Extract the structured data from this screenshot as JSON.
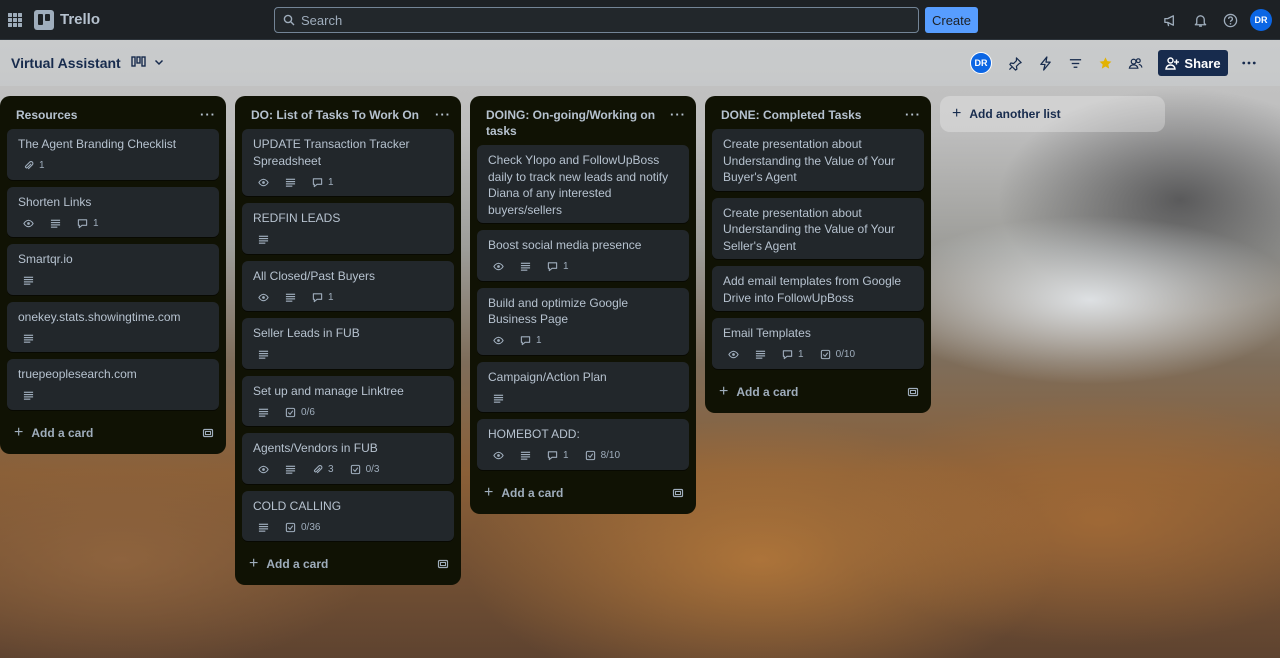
{
  "nav": {
    "app_name": "Trello",
    "search_placeholder": "Search",
    "create_label": "Create",
    "avatar_initials": "DR"
  },
  "board": {
    "title": "Virtual Assistant",
    "member_initials": "DR",
    "share_label": "Share"
  },
  "lists": [
    {
      "title": "Resources",
      "add_card_label": "Add a card",
      "cards": [
        {
          "title": "The Agent Branding Checklist",
          "attachments": "1"
        },
        {
          "title": "Shorten Links",
          "comments": "1"
        },
        {
          "title": "Smartqr.io"
        },
        {
          "title": "onekey.stats.showingtime.com"
        },
        {
          "title": "truepeoplesearch.com"
        }
      ]
    },
    {
      "title": "DO: List of Tasks To Work On",
      "add_card_label": "Add a card",
      "cards": [
        {
          "title": "UPDATE Transaction Tracker Spreadsheet",
          "comments": "1"
        },
        {
          "title": "REDFIN LEADS"
        },
        {
          "title": "All Closed/Past Buyers",
          "comments": "1"
        },
        {
          "title": "Seller Leads in FUB"
        },
        {
          "title": "Set up and manage Linktree",
          "checklist": "0/6"
        },
        {
          "title": "Agents/Vendors in FUB",
          "attachments": "3",
          "checklist": "0/3"
        },
        {
          "title": "COLD CALLING",
          "checklist": "0/36"
        }
      ]
    },
    {
      "title": "DOING: On-going/Working on tasks",
      "add_card_label": "Add a card",
      "cards": [
        {
          "title": "Check Ylopo and FollowUpBoss daily to track new leads and notify Diana of any interested buyers/sellers"
        },
        {
          "title": "Boost social media presence",
          "comments": "1"
        },
        {
          "title": "Build and optimize Google Business Page",
          "comments": "1"
        },
        {
          "title": "Campaign/Action Plan"
        },
        {
          "title": "HOMEBOT ADD:",
          "comments": "1",
          "checklist": "8/10"
        }
      ]
    },
    {
      "title": "DONE: Completed Tasks",
      "add_card_label": "Add a card",
      "cards": [
        {
          "title": "Create presentation about Understanding the Value of Your Buyer's Agent"
        },
        {
          "title": "Create presentation about Understanding the Value of Your Seller's Agent"
        },
        {
          "title": "Add email templates from Google Drive into FollowUpBoss"
        },
        {
          "title": "Email Templates",
          "comments": "1",
          "checklist": "0/10"
        }
      ]
    }
  ],
  "add_list_label": "Add another list"
}
